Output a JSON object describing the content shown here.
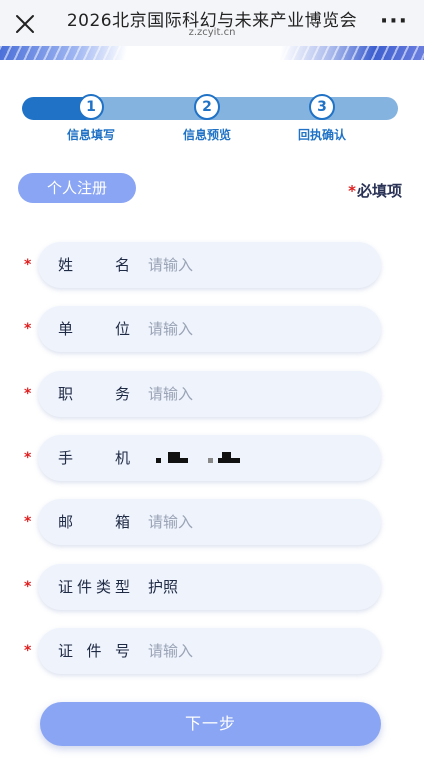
{
  "header": {
    "title": "2026北京国际科幻与未来产业博览会",
    "domain": "z.zcyit.cn"
  },
  "steps": {
    "progress": 0.2,
    "items": [
      {
        "number": "1",
        "label": "信息填写"
      },
      {
        "number": "2",
        "label": "信息预览"
      },
      {
        "number": "3",
        "label": "回执确认"
      }
    ]
  },
  "section": {
    "label": "个人注册",
    "required_star": "*",
    "required_text": "必填项"
  },
  "form": {
    "star": "*",
    "name": {
      "label": [
        "姓",
        "名"
      ],
      "placeholder": "请输入"
    },
    "company": {
      "label": [
        "单",
        "位"
      ],
      "placeholder": "请输入"
    },
    "title": {
      "label": [
        "职",
        "务"
      ],
      "placeholder": "请输入"
    },
    "phone": {
      "label": [
        "手",
        "机"
      ]
    },
    "email": {
      "label": [
        "邮",
        "箱"
      ],
      "placeholder": "请输入"
    },
    "id_type": {
      "label": [
        "证",
        "件",
        "类",
        "型"
      ],
      "value": "护照"
    },
    "id_no": {
      "label": [
        "证",
        "件",
        "号"
      ],
      "placeholder": "请输入"
    }
  },
  "next_button": "下一步",
  "colors": {
    "accent": "#1f72c6",
    "button": "#8aa5f3",
    "required": "#e02020",
    "field_bg": "#eef3fc"
  }
}
